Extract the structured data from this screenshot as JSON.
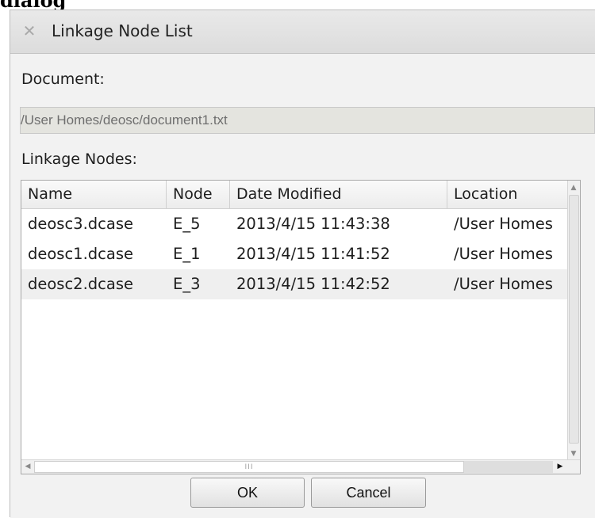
{
  "caption": "dialog",
  "dialog": {
    "title": "Linkage Node List",
    "close_icon": "close-icon"
  },
  "document": {
    "label": "Document:",
    "path": "/User Homes/deosc/document1.txt"
  },
  "linkage": {
    "label": "Linkage Nodes:",
    "columns": [
      "Name",
      "Node",
      "Date Modified",
      "Location"
    ],
    "rows": [
      {
        "name": "deosc3.dcase",
        "node": "E_5",
        "date": "2013/4/15 11:43:38",
        "location": "/User Homes"
      },
      {
        "name": "deosc1.dcase",
        "node": "E_1",
        "date": "2013/4/15 11:41:52",
        "location": "/User Homes"
      },
      {
        "name": "deosc2.dcase",
        "node": "E_3",
        "date": "2013/4/15 11:42:52",
        "location": "/User Homes"
      }
    ],
    "hscroll_grip": "III"
  },
  "buttons": {
    "ok": "OK",
    "cancel": "Cancel"
  }
}
